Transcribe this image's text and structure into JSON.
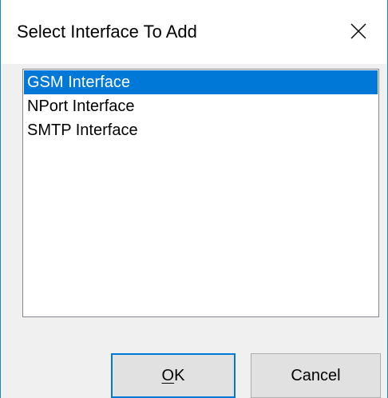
{
  "dialog": {
    "title": "Select Interface To Add",
    "close_icon": "close-icon"
  },
  "interfaces": {
    "items": [
      {
        "label": "GSM Interface",
        "selected": true
      },
      {
        "label": "NPort Interface",
        "selected": false
      },
      {
        "label": "SMTP Interface",
        "selected": false
      }
    ]
  },
  "buttons": {
    "ok_label_mnemonic": "O",
    "ok_label_rest": "K",
    "cancel_label": "Cancel"
  },
  "colors": {
    "selection": "#0078d7",
    "window_border": "#1883d7",
    "dialog_bg": "#f0f0f0"
  }
}
